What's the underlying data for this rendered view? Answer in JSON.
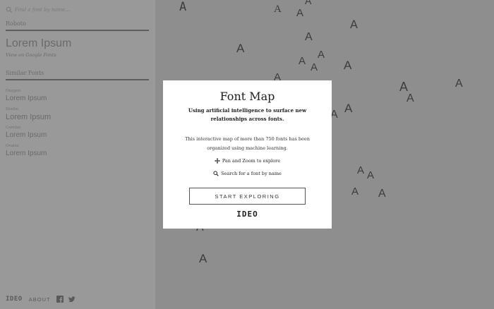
{
  "search": {
    "placeholder": "Find a font by name..."
  },
  "current_font": {
    "name": "Roboto",
    "preview": "Lorem Ipsum",
    "link_label": "View on Google Fonts"
  },
  "similar": {
    "heading": "Similar Fonts",
    "items": [
      {
        "name": "Oxygen",
        "sample": "Lorem Ipsum"
      },
      {
        "name": "Heebo",
        "sample": "Lorem Ipsum"
      },
      {
        "name": "Carelay",
        "sample": "Lorem Ipsum"
      },
      {
        "name": "Ovalez",
        "sample": "Lorem Ipsum"
      }
    ]
  },
  "footer": {
    "logo": "IDEO",
    "about": "ABOUT",
    "facebook_icon": "facebook-icon",
    "twitter_icon": "twitter-icon"
  },
  "map": {
    "glyph_char": "A",
    "glyph_color": "#3c3c3c"
  },
  "modal": {
    "title": "Font Map",
    "subtitle": "Using artificial intelligence to surface new relationships across fonts.",
    "description": "This interactive map of more than 750 fonts has been organized using machine learning.",
    "hint_pan": "Pan and Zoom to explore",
    "hint_search": "Search for a font by name",
    "button_label": "START EXPLORING",
    "logo": "IDEO"
  },
  "colors": {
    "sidebar_bg": "#999999",
    "overlay_bg": "#8e8e8e",
    "modal_bg": "#ffffff"
  }
}
